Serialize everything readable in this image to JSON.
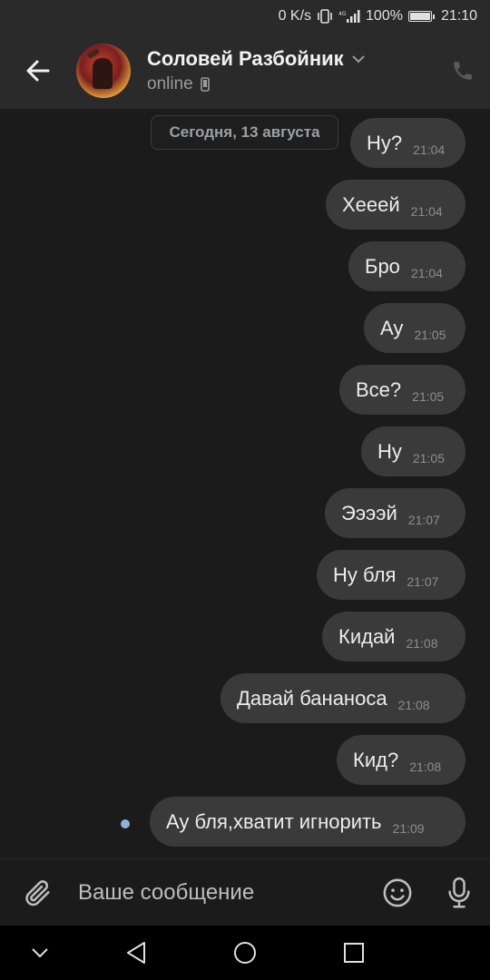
{
  "status_bar": {
    "net_speed": "0 K/s",
    "battery_percent": "100%",
    "battery_level": 1.0,
    "time": "21:10",
    "network_type": "4G"
  },
  "header": {
    "contact_name": "Соловей Разбойник",
    "presence": "online",
    "icons": [
      "arrow-back-icon",
      "chevron-down-icon",
      "mobile-device-icon",
      "phone-icon"
    ]
  },
  "chat": {
    "date_label": "Сегодня, 13 августа",
    "messages": [
      {
        "text": "Ну?",
        "time": "21:04"
      },
      {
        "text": "Хееей",
        "time": "21:04"
      },
      {
        "text": "Бро",
        "time": "21:04"
      },
      {
        "text": "Ау",
        "time": "21:05"
      },
      {
        "text": "Все?",
        "time": "21:05"
      },
      {
        "text": "Ну",
        "time": "21:05"
      },
      {
        "text": "Ээээй",
        "time": "21:07"
      },
      {
        "text": "Ну бля",
        "time": "21:07"
      },
      {
        "text": "Кидай",
        "time": "21:08"
      },
      {
        "text": "Давай бананоса",
        "time": "21:08"
      },
      {
        "text": "Кид?",
        "time": "21:08"
      },
      {
        "text": "Ау бля,хватит игнорить",
        "time": "21:09"
      }
    ]
  },
  "composer": {
    "placeholder": "Ваше сообщение",
    "value": "",
    "icons": [
      "paperclip-icon",
      "emoji-icon",
      "microphone-icon"
    ]
  },
  "colors": {
    "background": "#1b1b1b",
    "header": "#2a2a2a",
    "bubble": "#3a3a3a",
    "unread_dot": "#8fb1d9"
  }
}
